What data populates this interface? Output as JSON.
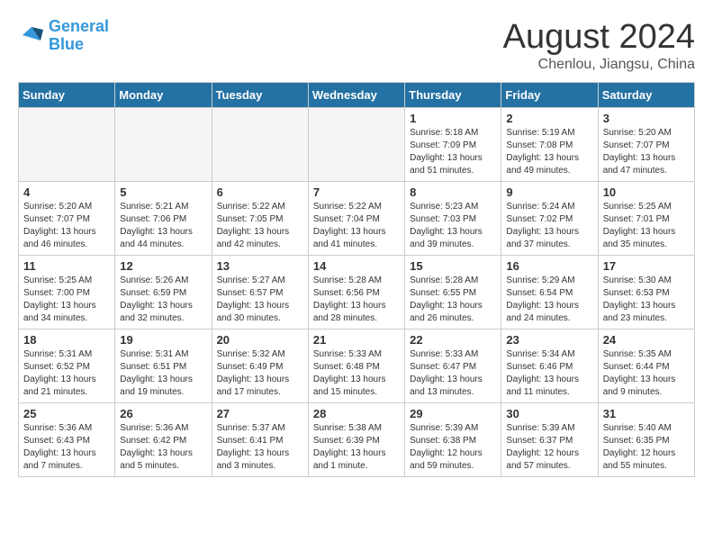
{
  "header": {
    "logo_line1": "General",
    "logo_line2": "Blue",
    "month_title": "August 2024",
    "location": "Chenlou, Jiangsu, China"
  },
  "days_of_week": [
    "Sunday",
    "Monday",
    "Tuesday",
    "Wednesday",
    "Thursday",
    "Friday",
    "Saturday"
  ],
  "weeks": [
    [
      {
        "day": "",
        "info": ""
      },
      {
        "day": "",
        "info": ""
      },
      {
        "day": "",
        "info": ""
      },
      {
        "day": "",
        "info": ""
      },
      {
        "day": "1",
        "info": "Sunrise: 5:18 AM\nSunset: 7:09 PM\nDaylight: 13 hours\nand 51 minutes."
      },
      {
        "day": "2",
        "info": "Sunrise: 5:19 AM\nSunset: 7:08 PM\nDaylight: 13 hours\nand 49 minutes."
      },
      {
        "day": "3",
        "info": "Sunrise: 5:20 AM\nSunset: 7:07 PM\nDaylight: 13 hours\nand 47 minutes."
      }
    ],
    [
      {
        "day": "4",
        "info": "Sunrise: 5:20 AM\nSunset: 7:07 PM\nDaylight: 13 hours\nand 46 minutes."
      },
      {
        "day": "5",
        "info": "Sunrise: 5:21 AM\nSunset: 7:06 PM\nDaylight: 13 hours\nand 44 minutes."
      },
      {
        "day": "6",
        "info": "Sunrise: 5:22 AM\nSunset: 7:05 PM\nDaylight: 13 hours\nand 42 minutes."
      },
      {
        "day": "7",
        "info": "Sunrise: 5:22 AM\nSunset: 7:04 PM\nDaylight: 13 hours\nand 41 minutes."
      },
      {
        "day": "8",
        "info": "Sunrise: 5:23 AM\nSunset: 7:03 PM\nDaylight: 13 hours\nand 39 minutes."
      },
      {
        "day": "9",
        "info": "Sunrise: 5:24 AM\nSunset: 7:02 PM\nDaylight: 13 hours\nand 37 minutes."
      },
      {
        "day": "10",
        "info": "Sunrise: 5:25 AM\nSunset: 7:01 PM\nDaylight: 13 hours\nand 35 minutes."
      }
    ],
    [
      {
        "day": "11",
        "info": "Sunrise: 5:25 AM\nSunset: 7:00 PM\nDaylight: 13 hours\nand 34 minutes."
      },
      {
        "day": "12",
        "info": "Sunrise: 5:26 AM\nSunset: 6:59 PM\nDaylight: 13 hours\nand 32 minutes."
      },
      {
        "day": "13",
        "info": "Sunrise: 5:27 AM\nSunset: 6:57 PM\nDaylight: 13 hours\nand 30 minutes."
      },
      {
        "day": "14",
        "info": "Sunrise: 5:28 AM\nSunset: 6:56 PM\nDaylight: 13 hours\nand 28 minutes."
      },
      {
        "day": "15",
        "info": "Sunrise: 5:28 AM\nSunset: 6:55 PM\nDaylight: 13 hours\nand 26 minutes."
      },
      {
        "day": "16",
        "info": "Sunrise: 5:29 AM\nSunset: 6:54 PM\nDaylight: 13 hours\nand 24 minutes."
      },
      {
        "day": "17",
        "info": "Sunrise: 5:30 AM\nSunset: 6:53 PM\nDaylight: 13 hours\nand 23 minutes."
      }
    ],
    [
      {
        "day": "18",
        "info": "Sunrise: 5:31 AM\nSunset: 6:52 PM\nDaylight: 13 hours\nand 21 minutes."
      },
      {
        "day": "19",
        "info": "Sunrise: 5:31 AM\nSunset: 6:51 PM\nDaylight: 13 hours\nand 19 minutes."
      },
      {
        "day": "20",
        "info": "Sunrise: 5:32 AM\nSunset: 6:49 PM\nDaylight: 13 hours\nand 17 minutes."
      },
      {
        "day": "21",
        "info": "Sunrise: 5:33 AM\nSunset: 6:48 PM\nDaylight: 13 hours\nand 15 minutes."
      },
      {
        "day": "22",
        "info": "Sunrise: 5:33 AM\nSunset: 6:47 PM\nDaylight: 13 hours\nand 13 minutes."
      },
      {
        "day": "23",
        "info": "Sunrise: 5:34 AM\nSunset: 6:46 PM\nDaylight: 13 hours\nand 11 minutes."
      },
      {
        "day": "24",
        "info": "Sunrise: 5:35 AM\nSunset: 6:44 PM\nDaylight: 13 hours\nand 9 minutes."
      }
    ],
    [
      {
        "day": "25",
        "info": "Sunrise: 5:36 AM\nSunset: 6:43 PM\nDaylight: 13 hours\nand 7 minutes."
      },
      {
        "day": "26",
        "info": "Sunrise: 5:36 AM\nSunset: 6:42 PM\nDaylight: 13 hours\nand 5 minutes."
      },
      {
        "day": "27",
        "info": "Sunrise: 5:37 AM\nSunset: 6:41 PM\nDaylight: 13 hours\nand 3 minutes."
      },
      {
        "day": "28",
        "info": "Sunrise: 5:38 AM\nSunset: 6:39 PM\nDaylight: 13 hours\nand 1 minute."
      },
      {
        "day": "29",
        "info": "Sunrise: 5:39 AM\nSunset: 6:38 PM\nDaylight: 12 hours\nand 59 minutes."
      },
      {
        "day": "30",
        "info": "Sunrise: 5:39 AM\nSunset: 6:37 PM\nDaylight: 12 hours\nand 57 minutes."
      },
      {
        "day": "31",
        "info": "Sunrise: 5:40 AM\nSunset: 6:35 PM\nDaylight: 12 hours\nand 55 minutes."
      }
    ]
  ]
}
